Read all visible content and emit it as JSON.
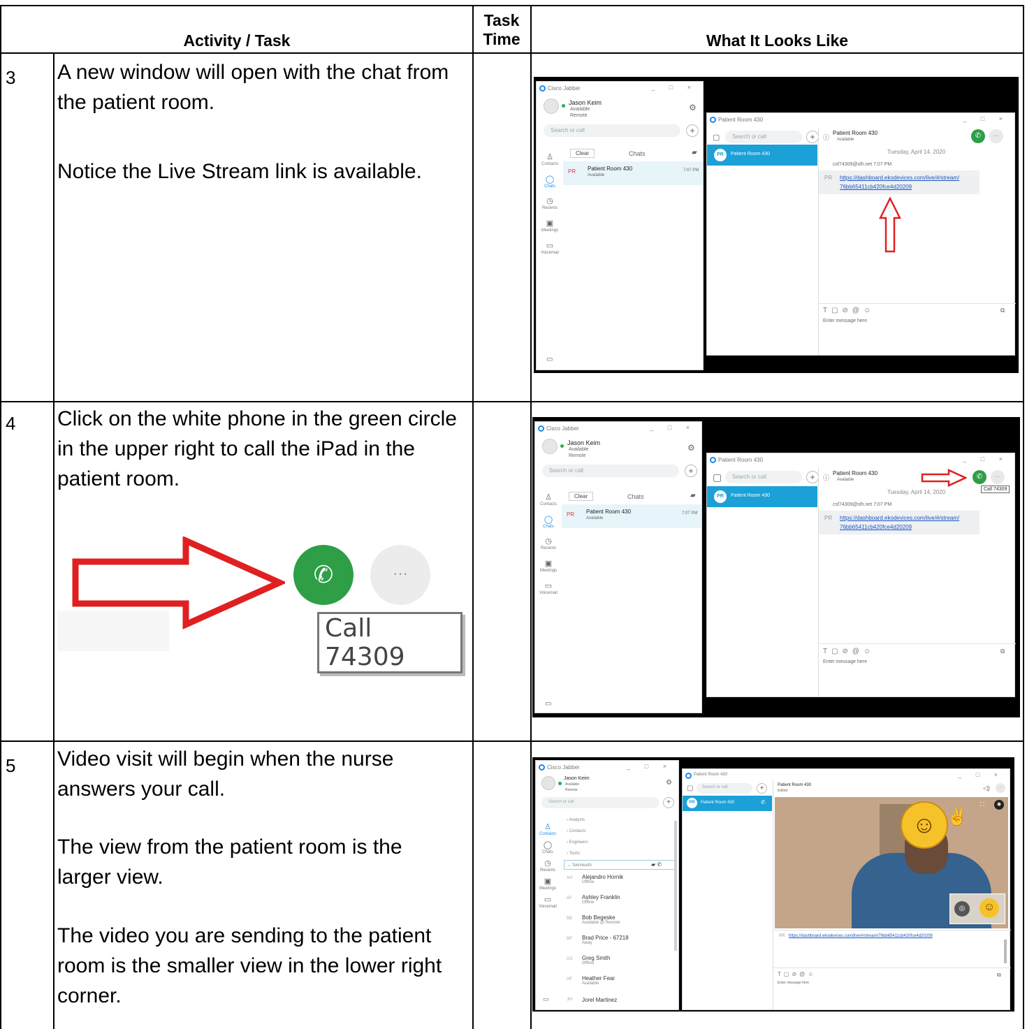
{
  "table": {
    "headers": {
      "activity": "Activity / Task",
      "task_time": "Task Time",
      "looks_like": "What It Looks Like"
    },
    "rows": [
      {
        "step": "3",
        "paragraphs": [
          "A new window will open with the chat from the patient room.",
          "Notice the Live Stream link is available."
        ]
      },
      {
        "step": "4",
        "paragraphs": [
          "Click on the white phone in the green circle in the upper right to call the iPad in the patient room."
        ],
        "callout_tooltip": "Call 74309"
      },
      {
        "step": "5",
        "paragraphs": [
          "Video visit will begin when the nurse answers your call.",
          "The view from the patient room is the larger view.",
          "The video you are sending to the patient room is the smaller view in the lower right corner."
        ]
      }
    ]
  },
  "jabber": {
    "app_title": "Cisco Jabber",
    "user_name": "Jason Keim",
    "user_status": "Available",
    "user_location": "Remote",
    "search_placeholder": "Search or call",
    "nav": [
      "Contacts",
      "Chats",
      "Recents",
      "Meetings",
      "Voicemail"
    ],
    "clear_label": "Clear",
    "chats_label": "Chats",
    "chat_contact": "Patient Room 430",
    "chat_contact_status": "Available",
    "chat_time": "7:07 PM",
    "chat_window_title": "Patient Room 430",
    "initials": "PR",
    "date_header": "Tuesday, April 14, 2020",
    "sender_line": "csf74309@slh.net 7:07 PM",
    "stream_link_line1": "https://dashboard.ekodevices.com/live/#/stream/",
    "stream_link_line2": "76bb65411cb420fce4d20209",
    "stream_link_full": "https://dashboard.ekodevices.com/live/#/stream/76bb65411cb420fce4d20209",
    "message_placeholder": "Enter message here",
    "call_tooltip": "Call 74309",
    "contact_groups": [
      "Analysts",
      "Contacts",
      "Engineers",
      "Techs",
      "TeleHealth"
    ],
    "contacts": [
      {
        "initials": "AH",
        "name": "Alejandro Hornik",
        "status": "Offline"
      },
      {
        "initials": "AF",
        "name": "Ashley Franklin",
        "status": "Offline"
      },
      {
        "initials": "BB",
        "name": "Bob Begeske",
        "status": "Available @ Remote"
      },
      {
        "initials": "BP",
        "name": "Brad Price - 67218",
        "status": "Away"
      },
      {
        "initials": "GS",
        "name": "Greg Smith",
        "status": "Offline"
      },
      {
        "initials": "HF",
        "name": "Heather Fear",
        "status": "Available"
      },
      {
        "initials": "JM",
        "name": "Jorel Martinez",
        "status": ""
      }
    ],
    "video_subtitle": "Edited",
    "accent_blue": "#1ba0d7",
    "call_green": "#2e9e47",
    "arrow_red": "#e02020"
  }
}
